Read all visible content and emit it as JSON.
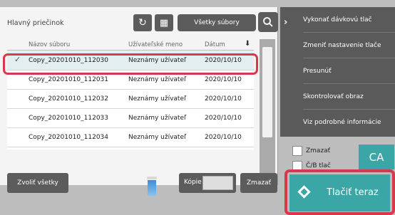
{
  "header": {
    "folder_title": "Hlavný priečinok",
    "refresh_glyph": "↻",
    "grid_glyph": "▦",
    "all_files_label": "Všetky súbory",
    "search_glyph": "⚲"
  },
  "table": {
    "columns": [
      "Názov súboru",
      "Užívateľské meno",
      "Dátum"
    ],
    "sort_glyph": "⬇",
    "rows": [
      {
        "filename": "Copy_20201010_112030",
        "user": "Neznámy užívateľ",
        "date": "2020/10/10",
        "selected": true
      },
      {
        "filename": "Copy_20201010_112031",
        "user": "Neznámy užívateľ",
        "date": "2020/10/10",
        "selected": false
      },
      {
        "filename": "Copy_20201010_112032",
        "user": "Neznámy užívateľ",
        "date": "2020/10/10",
        "selected": false
      },
      {
        "filename": "Copy_20201010_112033",
        "user": "Neznámy užívateľ",
        "date": "2020/10/10",
        "selected": false
      },
      {
        "filename": "Copy_20201010_112034",
        "user": "Neznámy užívateľ",
        "date": "2020/10/10",
        "selected": false
      }
    ],
    "check_glyph": "✓"
  },
  "menu": {
    "arrow_glyph": "›",
    "items": [
      "Vykonať dávkovú tlač",
      "Zmeniť nastavenie tlače",
      "Presunúť",
      "Skontrolovať obraz",
      "Viz podrobné informácie"
    ]
  },
  "options": {
    "delete_label": "Zmazať",
    "bw_label": "Č/B tlač"
  },
  "actions": {
    "ca_label": "CA",
    "print_now_label": "Tlačiť teraz",
    "select_all_label": "Zvoliť všetky",
    "copies_label": "Kópie",
    "delete_label": "Zmazať"
  },
  "colors": {
    "accent": "#3aa6a6",
    "highlight": "#d9384c"
  }
}
